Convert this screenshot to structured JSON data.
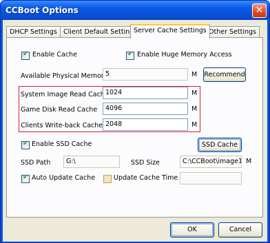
{
  "window": {
    "title": "CCBoot Options",
    "close_glyph": "✕"
  },
  "tabs": [
    {
      "label": "DHCP Settings"
    },
    {
      "label": "Client Default Settings"
    },
    {
      "label": "Server Cache Settings"
    },
    {
      "label": "Other Settings"
    }
  ],
  "cache": {
    "enable_cache": {
      "label": "Enable Cache",
      "checked": true
    },
    "enable_huge_memory": {
      "label": "Enable Huge Memory Access",
      "checked": true
    },
    "available_physical_memory": {
      "label": "Available Physical Memory",
      "value": "5",
      "unit": "M"
    },
    "recommend_label": "Recommend",
    "system_image_read_cache": {
      "label": "System Image Read Cache",
      "value": "1024",
      "unit": "M"
    },
    "game_disk_read_cache": {
      "label": "Game Disk Read Cache",
      "value": "4096",
      "unit": "M"
    },
    "clients_writeback_cache": {
      "label": "Clients Write-back Cache",
      "value": "2048",
      "unit": "M"
    }
  },
  "ssd": {
    "enable_ssd_cache": {
      "label": "Enable SSD Cache",
      "checked": true
    },
    "ssd_cache_button": "SSD Cache",
    "ssd_path": {
      "label": "SSD Path",
      "value": "G:\\"
    },
    "ssd_size": {
      "label": "SSD Size",
      "value": "C:\\CCBoot\\image1",
      "unit": "M"
    },
    "auto_update_cache": {
      "label": "Auto Update Cache",
      "checked": true
    },
    "update_cache_time": {
      "label": "Update Cache Time",
      "checked": false,
      "value": ""
    }
  },
  "footer": {
    "ok_label": "OK",
    "cancel_label": "Cancel"
  },
  "colors": {
    "highlight": "#e01830",
    "title_bar": "#0a54e0",
    "dialog_bg": "#ece9d8"
  }
}
